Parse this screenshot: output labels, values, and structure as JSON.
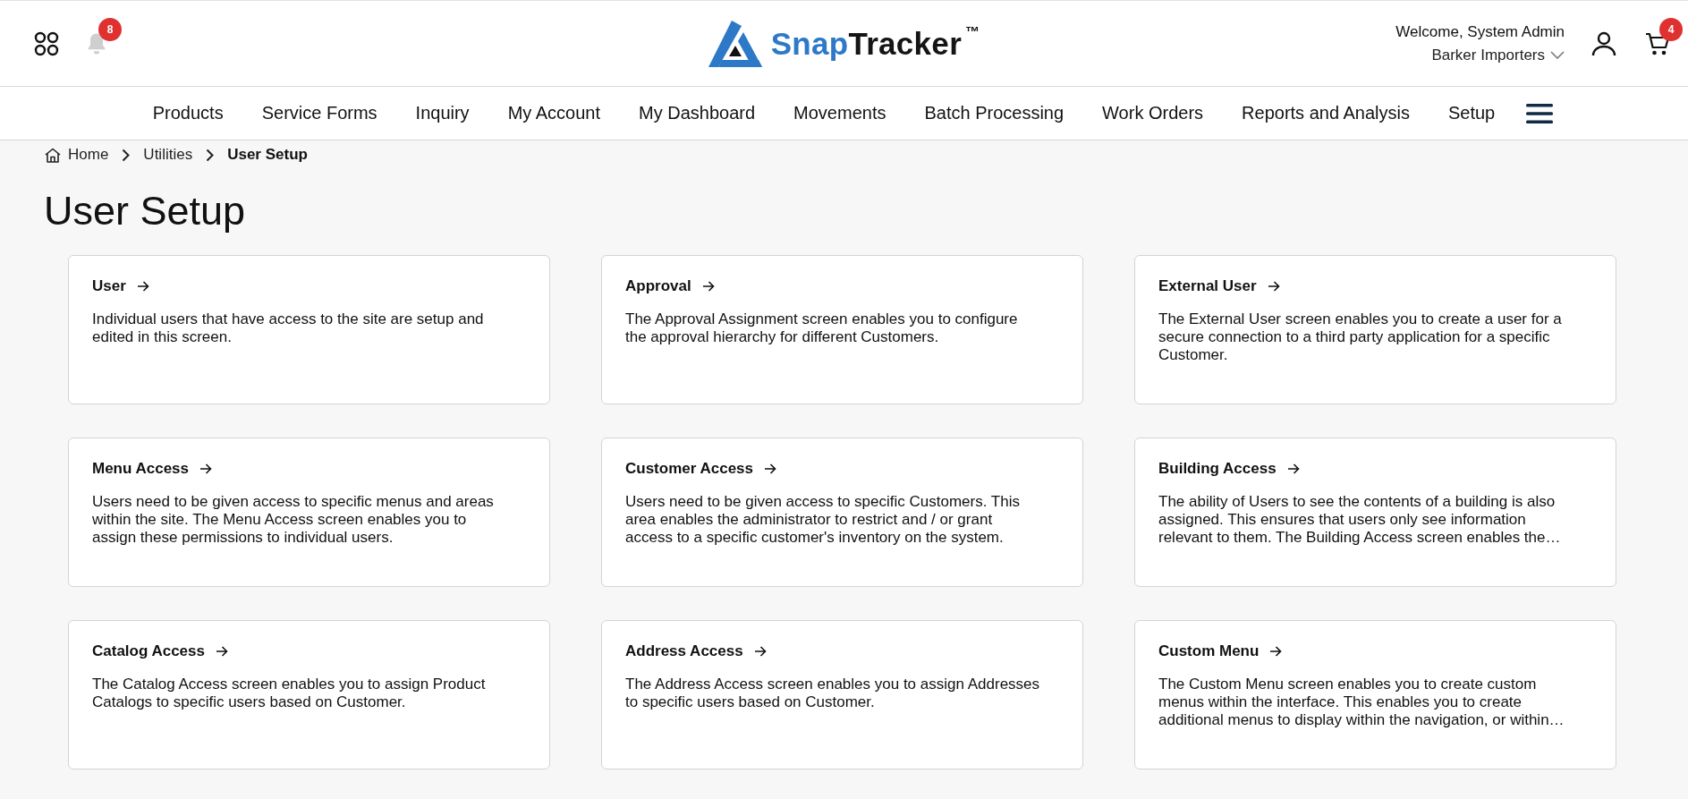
{
  "header": {
    "notifications_badge": "8",
    "logo": {
      "brand_primary": "Snap",
      "brand_secondary": "Tracker",
      "trademark": "™"
    },
    "welcome": "Welcome, System Admin",
    "company": "Barker Importers",
    "cart_badge": "4"
  },
  "nav": {
    "items": [
      "Products",
      "Service Forms",
      "Inquiry",
      "My Account",
      "My Dashboard",
      "Movements",
      "Batch Processing",
      "Work Orders",
      "Reports and Analysis",
      "Setup"
    ]
  },
  "breadcrumb": [
    {
      "label": "Home",
      "kind": "home",
      "current": false
    },
    {
      "label": "Utilities",
      "kind": "link",
      "current": false
    },
    {
      "label": "User Setup",
      "kind": "link",
      "current": true
    }
  ],
  "page_title": "User Setup",
  "cards": [
    {
      "title": "User",
      "description": "Individual users that have access to the site are setup and edited in this screen."
    },
    {
      "title": "Approval",
      "description": "The Approval Assignment screen enables you to configure the approval hierarchy for different Customers."
    },
    {
      "title": "External User",
      "description": "The External User screen enables you to create a user for a secure connection to a third party application for a specific Customer."
    },
    {
      "title": "Menu Access",
      "description": "Users need to be given access to specific menus and areas within the site. The Menu Access screen enables you to assign these permissions to individual users."
    },
    {
      "title": "Customer Access",
      "description": "Users need to be given access to specific Customers. This area enables the administrator to restrict and / or grant access to a specific customer's inventory on the system."
    },
    {
      "title": "Building Access",
      "description": "The ability of Users to see the contents of a building is also assigned. This ensures that users only see information relevant to them. The Building Access screen enables the…"
    },
    {
      "title": "Catalog Access",
      "description": "The Catalog Access screen enables you to assign Product Catalogs to specific users based on Customer."
    },
    {
      "title": "Address Access",
      "description": "The Address Access screen enables you to assign Addresses to specific users based on Customer."
    },
    {
      "title": "Custom Menu",
      "description": "The Custom Menu screen enables you to create custom menus within the interface. This enables you to create additional menus to display within the navigation, or within…"
    }
  ]
}
